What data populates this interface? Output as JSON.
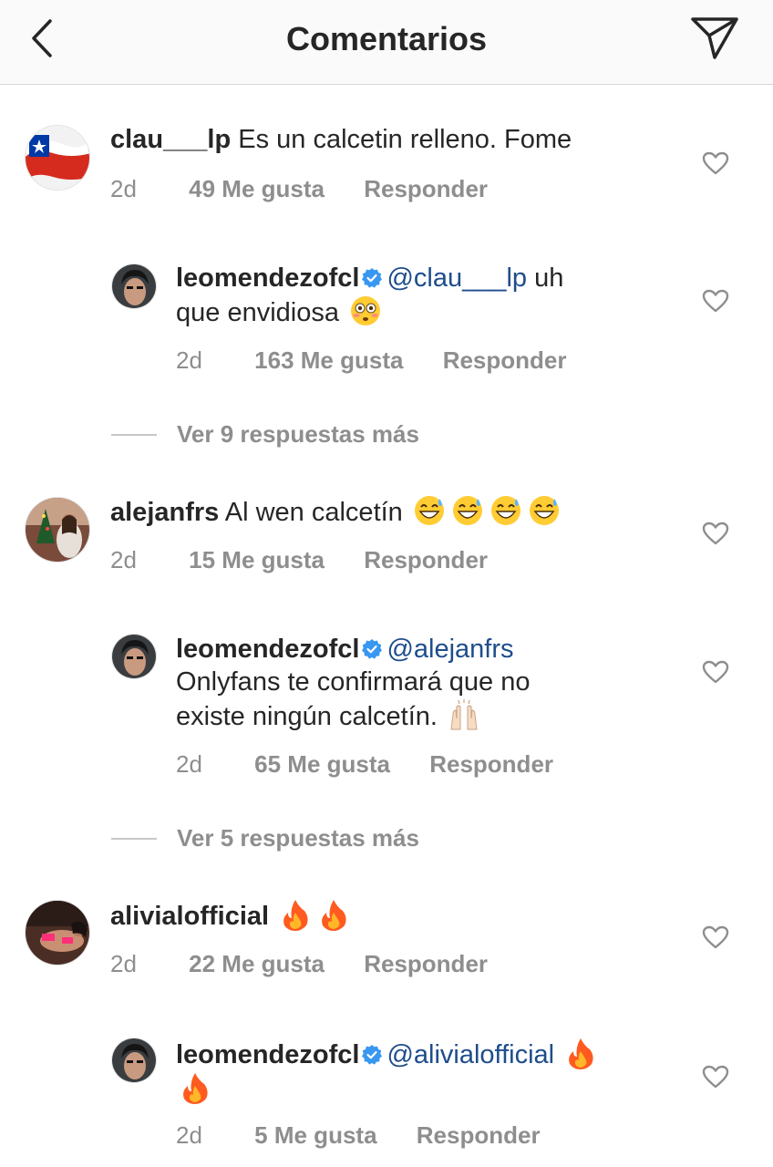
{
  "header": {
    "title": "Comentarios",
    "back_icon": "chevron-left-icon",
    "share_icon": "paper-plane-icon"
  },
  "comments": [
    {
      "user": "clau___lp",
      "text": "Es un calcetin relleno. Fome",
      "time": "2d",
      "likes": "49 Me gusta",
      "reply": "Responder",
      "replies": [
        {
          "user": "leomendezofcl",
          "verified": true,
          "mention": "@clau___lp",
          "text_line1": "uh",
          "text_line2": "que envidiosa",
          "emoji": "flushed-face",
          "time": "2d",
          "likes": "163 Me gusta",
          "reply": "Responder"
        }
      ],
      "more_replies": "Ver 9 respuestas más"
    },
    {
      "user": "alejanfrs",
      "text": "Al wen calcetín",
      "emoji": "grinning-sweat-face",
      "time": "2d",
      "likes": "15 Me gusta",
      "reply": "Responder",
      "replies": [
        {
          "user": "leomendezofcl",
          "verified": true,
          "mention": "@alejanfrs",
          "text_line1": "Onlyfans te confirmará que no",
          "text_line2": "existe ningún calcetín.",
          "emoji": "raising-hands",
          "time": "2d",
          "likes": "65 Me gusta",
          "reply": "Responder"
        }
      ],
      "more_replies": "Ver 5 respuestas más"
    },
    {
      "user": "alivialofficial",
      "text": "",
      "emoji": "fire",
      "time": "2d",
      "likes": "22 Me gusta",
      "reply": "Responder",
      "replies": [
        {
          "user": "leomendezofcl",
          "verified": true,
          "mention": "@alivialofficial",
          "emoji": "fire",
          "time": "2d",
          "likes": "5 Me gusta",
          "reply": "Responder"
        }
      ]
    }
  ],
  "colors": {
    "mention": "#1e4d8c",
    "meta": "#8e8e8e",
    "verified": "#3897f0"
  }
}
